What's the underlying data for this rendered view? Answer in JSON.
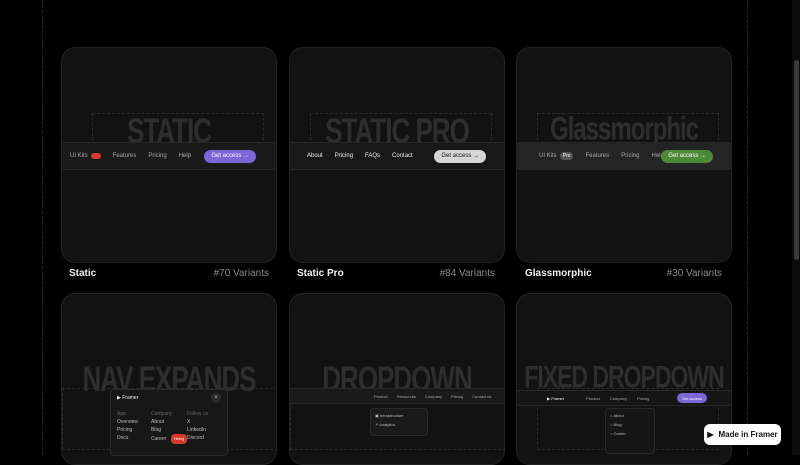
{
  "cards": [
    {
      "heading": "STATIC",
      "name": "Static",
      "variants": "#70 Variants",
      "nav": {
        "links": [
          "UI Kits",
          "Features",
          "Pricing",
          "Help"
        ],
        "pill": "",
        "cta": "Get access"
      }
    },
    {
      "heading": "STATIC PRO",
      "name": "Static Pro",
      "variants": "#84 Variants",
      "nav": {
        "links": [
          "About",
          "Pricing",
          "FAQs",
          "Contact"
        ],
        "cta": "Get access"
      }
    },
    {
      "heading": "Glassmorphic",
      "name": "Glassmorphic",
      "variants": "#30 Variants",
      "nav": {
        "links": [
          "UI Kits",
          "Features",
          "Pricing",
          "Help"
        ],
        "pill": "Pro",
        "cta": "Get access"
      }
    },
    {
      "heading": "NAV EXPANDS",
      "menu": {
        "brand": "Framer",
        "col1": {
          "head": "App",
          "items": [
            "Overview",
            "Pricing",
            "Docs"
          ]
        },
        "col2": {
          "head": "Company",
          "items": [
            "About",
            "Blog",
            "Career"
          ],
          "tag": "Hiring"
        },
        "col3": {
          "head": "Follow us",
          "items": [
            "X",
            "LinkedIn",
            "Discord"
          ]
        }
      }
    },
    {
      "heading": "DROPDOWN",
      "nav": {
        "links": [
          "Product",
          "Resources",
          "Company",
          "Pricing",
          "Contact us"
        ]
      },
      "menu": {
        "items": [
          "Infrastructure",
          "Analytics"
        ]
      }
    },
    {
      "heading": "FIXED DROPDOWN",
      "nav": {
        "brand": "Framer",
        "links": [
          "Product",
          "Company",
          "Pricing"
        ],
        "cta": "Get access"
      },
      "menu": {
        "items": [
          "About",
          "Blog",
          "Career"
        ]
      }
    }
  ],
  "badge": {
    "label": "Made in Framer"
  },
  "colors": {
    "cta_purple": "#7b66d6",
    "cta_white": "#d6d6d6",
    "cta_green": "#4d8a35",
    "pill_red": "#d63a2c"
  }
}
